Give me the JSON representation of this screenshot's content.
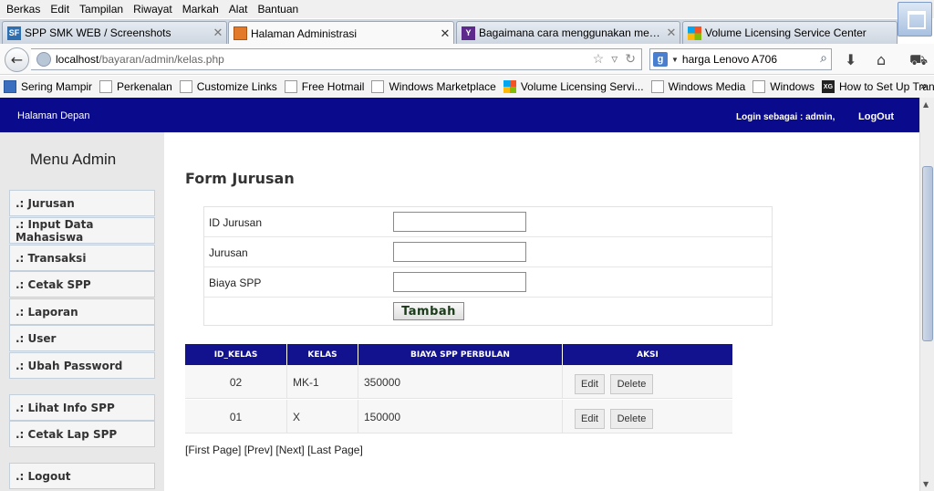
{
  "menu": [
    "Berkas",
    "Edit",
    "Tampilan",
    "Riwayat",
    "Markah",
    "Alat",
    "Bantuan"
  ],
  "tabs": [
    {
      "title": "SPP SMK WEB / Screenshots",
      "icon": "sf-icon"
    },
    {
      "title": "Halaman Administrasi",
      "icon": "page-icon",
      "active": true
    },
    {
      "title": "Bagaimana cara menggunakan mesin cuci...",
      "icon": "yahoo-icon"
    },
    {
      "title": "Volume Licensing Service Center",
      "icon": "ms-icon"
    }
  ],
  "address": {
    "host": "localhost",
    "path": "/bayaran/admin/kelas.php"
  },
  "search": {
    "value": "harga Lenovo A706"
  },
  "bookmarks": [
    "Sering Mampir",
    "Perkenalan",
    "Customize Links",
    "Free Hotmail",
    "Windows Marketplace",
    "Volume Licensing Servi...",
    "Windows Media",
    "Windows",
    "How to Set Up Transp..."
  ],
  "bookmarks_more": "»",
  "header": {
    "home": "Halaman Depan",
    "login": "Login sebagai : admin,",
    "logout": "LogOut"
  },
  "sidebar": {
    "title": "Menu Admin",
    "items": [
      ".: Jurusan",
      ".: Input Data Mahasiswa",
      ".: Transaksi",
      ".: Cetak SPP",
      ".: Laporan",
      ".: User",
      ".: Ubah Password",
      ".: Lihat Info SPP",
      ".: Cetak Lap SPP",
      ".: Logout"
    ]
  },
  "form": {
    "title": "Form Jurusan",
    "fields": [
      {
        "label": "ID Jurusan",
        "value": ""
      },
      {
        "label": "Jurusan",
        "value": ""
      },
      {
        "label": "Biaya SPP",
        "value": ""
      }
    ],
    "submit": "Tambah"
  },
  "table": {
    "columns": [
      "ID_KELAS",
      "KELAS",
      "BIAYA SPP PERBULAN",
      "AKSI"
    ],
    "rows": [
      {
        "id": "02",
        "kelas": "MK-1",
        "biaya": "350000"
      },
      {
        "id": "01",
        "kelas": "X",
        "biaya": "150000"
      }
    ],
    "edit_label": "Edit",
    "delete_label": "Delete"
  },
  "pagination": {
    "first": "[First Page]",
    "prev": "[Prev]",
    "next": "[Next]",
    "last": "[Last Page]"
  }
}
